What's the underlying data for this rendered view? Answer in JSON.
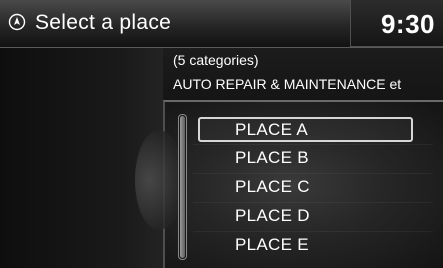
{
  "header": {
    "title": "Select a place",
    "clock": "9:30",
    "icon": "navigation-compass-icon"
  },
  "info": {
    "categories_count": "(5 categories)",
    "category_names": "AUTO REPAIR & MAINTENANCE et"
  },
  "list": {
    "items": [
      {
        "label": "PLACE A",
        "selected": true
      },
      {
        "label": "PLACE B",
        "selected": false
      },
      {
        "label": "PLACE C",
        "selected": false
      },
      {
        "label": "PLACE D",
        "selected": false
      },
      {
        "label": "PLACE E",
        "selected": false
      }
    ]
  },
  "colors": {
    "background": "#0a0a0a",
    "header": "#262626",
    "text": "#ffffff",
    "selection_border": "#d6d6d6"
  }
}
